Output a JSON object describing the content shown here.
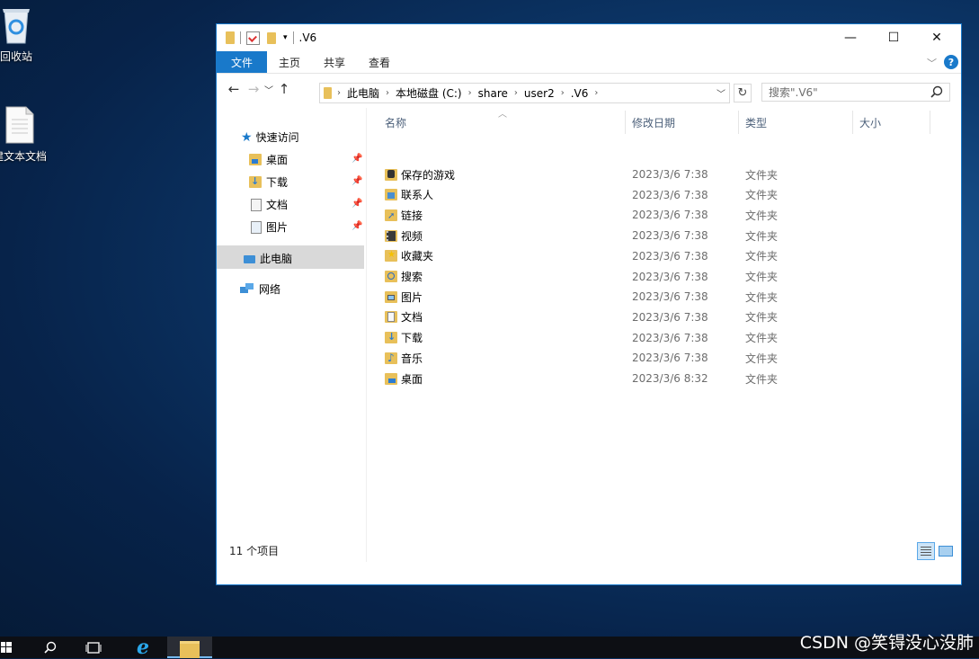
{
  "desktop": {
    "icons": [
      {
        "label": "回收站",
        "icon": "recycle-bin-icon"
      },
      {
        "label": "建文本文档",
        "icon": "text-document-icon"
      }
    ]
  },
  "window": {
    "title": ".V6",
    "caption": {
      "minimize": "—",
      "maximize": "☐",
      "close": "✕"
    },
    "ribbon_tabs": [
      "文件",
      "主页",
      "共享",
      "查看"
    ],
    "help": "?",
    "address": {
      "crumbs": [
        "此电脑",
        "本地磁盘 (C:)",
        "share",
        "user2",
        ".V6"
      ]
    },
    "search": {
      "placeholder": "搜索\".V6\""
    },
    "nav": {
      "quick_access": "快速访问",
      "quick_items": [
        "桌面",
        "下载",
        "文档",
        "图片"
      ],
      "this_pc": "此电脑",
      "network": "网络"
    },
    "columns": {
      "name": "名称",
      "date": "修改日期",
      "type": "类型",
      "size": "大小"
    },
    "files": [
      {
        "name": "保存的游戏",
        "date": "2023/3/6 7:38",
        "type": "文件夹",
        "icon": "saved-games-folder-icon"
      },
      {
        "name": "联系人",
        "date": "2023/3/6 7:38",
        "type": "文件夹",
        "icon": "contacts-folder-icon"
      },
      {
        "name": "链接",
        "date": "2023/3/6 7:38",
        "type": "文件夹",
        "icon": "links-folder-icon"
      },
      {
        "name": "视频",
        "date": "2023/3/6 7:38",
        "type": "文件夹",
        "icon": "videos-folder-icon"
      },
      {
        "name": "收藏夹",
        "date": "2023/3/6 7:38",
        "type": "文件夹",
        "icon": "favorites-folder-icon"
      },
      {
        "name": "搜索",
        "date": "2023/3/6 7:38",
        "type": "文件夹",
        "icon": "searches-folder-icon"
      },
      {
        "name": "图片",
        "date": "2023/3/6 7:38",
        "type": "文件夹",
        "icon": "pictures-folder-icon"
      },
      {
        "name": "文档",
        "date": "2023/3/6 7:38",
        "type": "文件夹",
        "icon": "documents-folder-icon"
      },
      {
        "name": "下载",
        "date": "2023/3/6 7:38",
        "type": "文件夹",
        "icon": "downloads-folder-icon"
      },
      {
        "name": "音乐",
        "date": "2023/3/6 7:38",
        "type": "文件夹",
        "icon": "music-folder-icon"
      },
      {
        "name": "桌面",
        "date": "2023/3/6 8:32",
        "type": "文件夹",
        "icon": "desktop-folder-icon"
      }
    ],
    "status": "11 个项目"
  },
  "watermark": "CSDN @笑锝没心没肺",
  "colors": {
    "accent": "#1979ca",
    "folder": "#e8c05a",
    "selected_nav": "#d9d9d9"
  }
}
